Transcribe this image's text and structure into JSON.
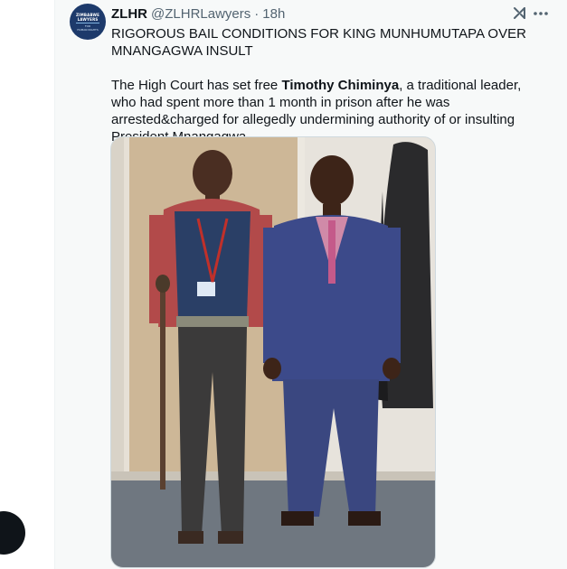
{
  "tweet": {
    "author_name": "ZLHR",
    "author_handle": "@ZLHRLawyers",
    "separator": "·",
    "time": "18h",
    "avatar": {
      "line1": "ZIMBABWE",
      "line2": "LAWYERS",
      "line3": "FOR",
      "line4": "HUMAN RIGHTS"
    },
    "text": {
      "line1": "RIGOROUS BAIL CONDITIONS FOR KING MUNHUMUTAPA OVER MNANGAGWA INSULT",
      "para2_prefix": "The High Court has set free ",
      "para2_bold": "Timothy Chiminya",
      "para2_suffix": ", a traditional leader, who had spent more than 1 month in prison after he was arrested&charged for allegedly undermining authority of or insulting President Mnangagwa"
    },
    "icons": {
      "grok": "grok-icon",
      "more": "more-options-icon",
      "fab": "floating-action-button"
    },
    "colors": {
      "background": "#f7f9f9",
      "text": "#0f1419",
      "secondary": "#536471",
      "avatar_bg": "#1d3a6b"
    }
  }
}
